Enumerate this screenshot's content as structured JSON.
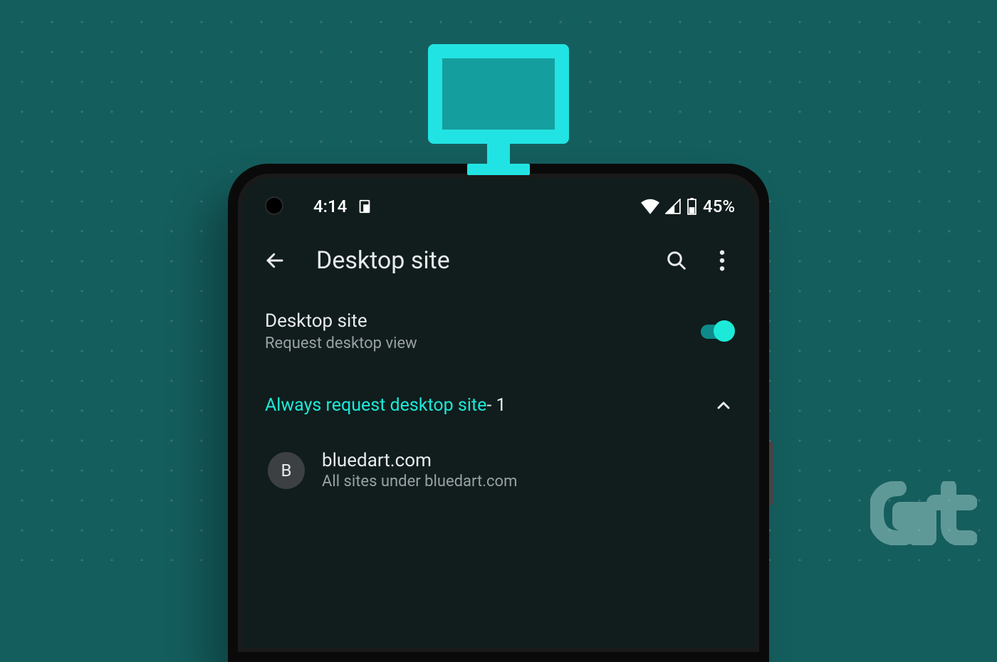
{
  "statusBar": {
    "time": "4:14",
    "battery": "45%"
  },
  "appBar": {
    "title": "Desktop site"
  },
  "toggleSetting": {
    "title": "Desktop site",
    "subtitle": "Request desktop view",
    "enabled": true
  },
  "section": {
    "label": "Always request desktop site",
    "count": " - 1"
  },
  "sites": [
    {
      "initial": "B",
      "domain": "bluedart.com",
      "subtitle": "All sites under bluedart.com"
    }
  ],
  "colors": {
    "accent": "#1de9d9",
    "background": "#155e5e",
    "screen": "#101d1c"
  }
}
